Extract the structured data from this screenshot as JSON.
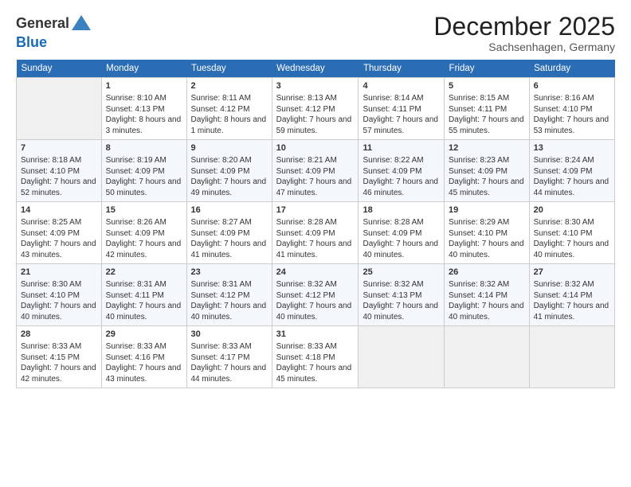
{
  "logo": {
    "general": "General",
    "blue": "Blue"
  },
  "header": {
    "month": "December 2025",
    "location": "Sachsenhagen, Germany"
  },
  "weekdays": [
    "Sunday",
    "Monday",
    "Tuesday",
    "Wednesday",
    "Thursday",
    "Friday",
    "Saturday"
  ],
  "weeks": [
    [
      {
        "day": "",
        "sunrise": "",
        "sunset": "",
        "daylight": ""
      },
      {
        "day": "1",
        "sunrise": "Sunrise: 8:10 AM",
        "sunset": "Sunset: 4:13 PM",
        "daylight": "Daylight: 8 hours and 3 minutes."
      },
      {
        "day": "2",
        "sunrise": "Sunrise: 8:11 AM",
        "sunset": "Sunset: 4:12 PM",
        "daylight": "Daylight: 8 hours and 1 minute."
      },
      {
        "day": "3",
        "sunrise": "Sunrise: 8:13 AM",
        "sunset": "Sunset: 4:12 PM",
        "daylight": "Daylight: 7 hours and 59 minutes."
      },
      {
        "day": "4",
        "sunrise": "Sunrise: 8:14 AM",
        "sunset": "Sunset: 4:11 PM",
        "daylight": "Daylight: 7 hours and 57 minutes."
      },
      {
        "day": "5",
        "sunrise": "Sunrise: 8:15 AM",
        "sunset": "Sunset: 4:11 PM",
        "daylight": "Daylight: 7 hours and 55 minutes."
      },
      {
        "day": "6",
        "sunrise": "Sunrise: 8:16 AM",
        "sunset": "Sunset: 4:10 PM",
        "daylight": "Daylight: 7 hours and 53 minutes."
      }
    ],
    [
      {
        "day": "7",
        "sunrise": "Sunrise: 8:18 AM",
        "sunset": "Sunset: 4:10 PM",
        "daylight": "Daylight: 7 hours and 52 minutes."
      },
      {
        "day": "8",
        "sunrise": "Sunrise: 8:19 AM",
        "sunset": "Sunset: 4:09 PM",
        "daylight": "Daylight: 7 hours and 50 minutes."
      },
      {
        "day": "9",
        "sunrise": "Sunrise: 8:20 AM",
        "sunset": "Sunset: 4:09 PM",
        "daylight": "Daylight: 7 hours and 49 minutes."
      },
      {
        "day": "10",
        "sunrise": "Sunrise: 8:21 AM",
        "sunset": "Sunset: 4:09 PM",
        "daylight": "Daylight: 7 hours and 47 minutes."
      },
      {
        "day": "11",
        "sunrise": "Sunrise: 8:22 AM",
        "sunset": "Sunset: 4:09 PM",
        "daylight": "Daylight: 7 hours and 46 minutes."
      },
      {
        "day": "12",
        "sunrise": "Sunrise: 8:23 AM",
        "sunset": "Sunset: 4:09 PM",
        "daylight": "Daylight: 7 hours and 45 minutes."
      },
      {
        "day": "13",
        "sunrise": "Sunrise: 8:24 AM",
        "sunset": "Sunset: 4:09 PM",
        "daylight": "Daylight: 7 hours and 44 minutes."
      }
    ],
    [
      {
        "day": "14",
        "sunrise": "Sunrise: 8:25 AM",
        "sunset": "Sunset: 4:09 PM",
        "daylight": "Daylight: 7 hours and 43 minutes."
      },
      {
        "day": "15",
        "sunrise": "Sunrise: 8:26 AM",
        "sunset": "Sunset: 4:09 PM",
        "daylight": "Daylight: 7 hours and 42 minutes."
      },
      {
        "day": "16",
        "sunrise": "Sunrise: 8:27 AM",
        "sunset": "Sunset: 4:09 PM",
        "daylight": "Daylight: 7 hours and 41 minutes."
      },
      {
        "day": "17",
        "sunrise": "Sunrise: 8:28 AM",
        "sunset": "Sunset: 4:09 PM",
        "daylight": "Daylight: 7 hours and 41 minutes."
      },
      {
        "day": "18",
        "sunrise": "Sunrise: 8:28 AM",
        "sunset": "Sunset: 4:09 PM",
        "daylight": "Daylight: 7 hours and 40 minutes."
      },
      {
        "day": "19",
        "sunrise": "Sunrise: 8:29 AM",
        "sunset": "Sunset: 4:10 PM",
        "daylight": "Daylight: 7 hours and 40 minutes."
      },
      {
        "day": "20",
        "sunrise": "Sunrise: 8:30 AM",
        "sunset": "Sunset: 4:10 PM",
        "daylight": "Daylight: 7 hours and 40 minutes."
      }
    ],
    [
      {
        "day": "21",
        "sunrise": "Sunrise: 8:30 AM",
        "sunset": "Sunset: 4:10 PM",
        "daylight": "Daylight: 7 hours and 40 minutes."
      },
      {
        "day": "22",
        "sunrise": "Sunrise: 8:31 AM",
        "sunset": "Sunset: 4:11 PM",
        "daylight": "Daylight: 7 hours and 40 minutes."
      },
      {
        "day": "23",
        "sunrise": "Sunrise: 8:31 AM",
        "sunset": "Sunset: 4:12 PM",
        "daylight": "Daylight: 7 hours and 40 minutes."
      },
      {
        "day": "24",
        "sunrise": "Sunrise: 8:32 AM",
        "sunset": "Sunset: 4:12 PM",
        "daylight": "Daylight: 7 hours and 40 minutes."
      },
      {
        "day": "25",
        "sunrise": "Sunrise: 8:32 AM",
        "sunset": "Sunset: 4:13 PM",
        "daylight": "Daylight: 7 hours and 40 minutes."
      },
      {
        "day": "26",
        "sunrise": "Sunrise: 8:32 AM",
        "sunset": "Sunset: 4:14 PM",
        "daylight": "Daylight: 7 hours and 40 minutes."
      },
      {
        "day": "27",
        "sunrise": "Sunrise: 8:32 AM",
        "sunset": "Sunset: 4:14 PM",
        "daylight": "Daylight: 7 hours and 41 minutes."
      }
    ],
    [
      {
        "day": "28",
        "sunrise": "Sunrise: 8:33 AM",
        "sunset": "Sunset: 4:15 PM",
        "daylight": "Daylight: 7 hours and 42 minutes."
      },
      {
        "day": "29",
        "sunrise": "Sunrise: 8:33 AM",
        "sunset": "Sunset: 4:16 PM",
        "daylight": "Daylight: 7 hours and 43 minutes."
      },
      {
        "day": "30",
        "sunrise": "Sunrise: 8:33 AM",
        "sunset": "Sunset: 4:17 PM",
        "daylight": "Daylight: 7 hours and 44 minutes."
      },
      {
        "day": "31",
        "sunrise": "Sunrise: 8:33 AM",
        "sunset": "Sunset: 4:18 PM",
        "daylight": "Daylight: 7 hours and 45 minutes."
      },
      {
        "day": "",
        "sunrise": "",
        "sunset": "",
        "daylight": ""
      },
      {
        "day": "",
        "sunrise": "",
        "sunset": "",
        "daylight": ""
      },
      {
        "day": "",
        "sunrise": "",
        "sunset": "",
        "daylight": ""
      }
    ]
  ]
}
